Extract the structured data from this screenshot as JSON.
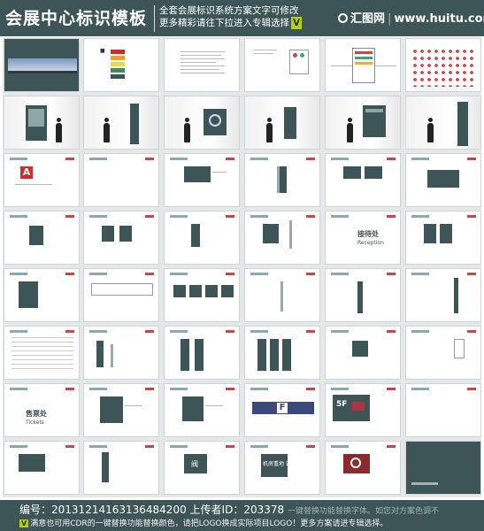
{
  "header": {
    "title": "会展中心标识模板",
    "desc_line1": "全套会展标识系统方案文字可修改",
    "desc_line2": "更多精彩请往下拉进入专辑选择",
    "desc_badge": "V",
    "logo_cn": "汇图网",
    "logo_url": "www.huitu.com"
  },
  "thumbs": {
    "a_letter": "A",
    "f_letter": "F",
    "reception_cn": "接待处",
    "reception_en": "Reception",
    "ticket_cn": "售票处",
    "ticket_en": "Tickets",
    "floor_label": "5F",
    "exit_cn": "机房重地 谢绝入内",
    "store_cn": "阀"
  },
  "footer": {
    "line1_prefix": "编号：",
    "line1_code": "20131214163136484200",
    "line1_uploader_label": "上传者ID：",
    "line1_uploader_id": "203378",
    "line1_tail": "一键替换功能替换字体。如您对方案色调不",
    "line2_badge": "V",
    "line2_text": "满意也可用CDR的一键替换功能替换颜色，请把LOGO换成实际项目LOGO！更多方案请进专辑选择。"
  }
}
